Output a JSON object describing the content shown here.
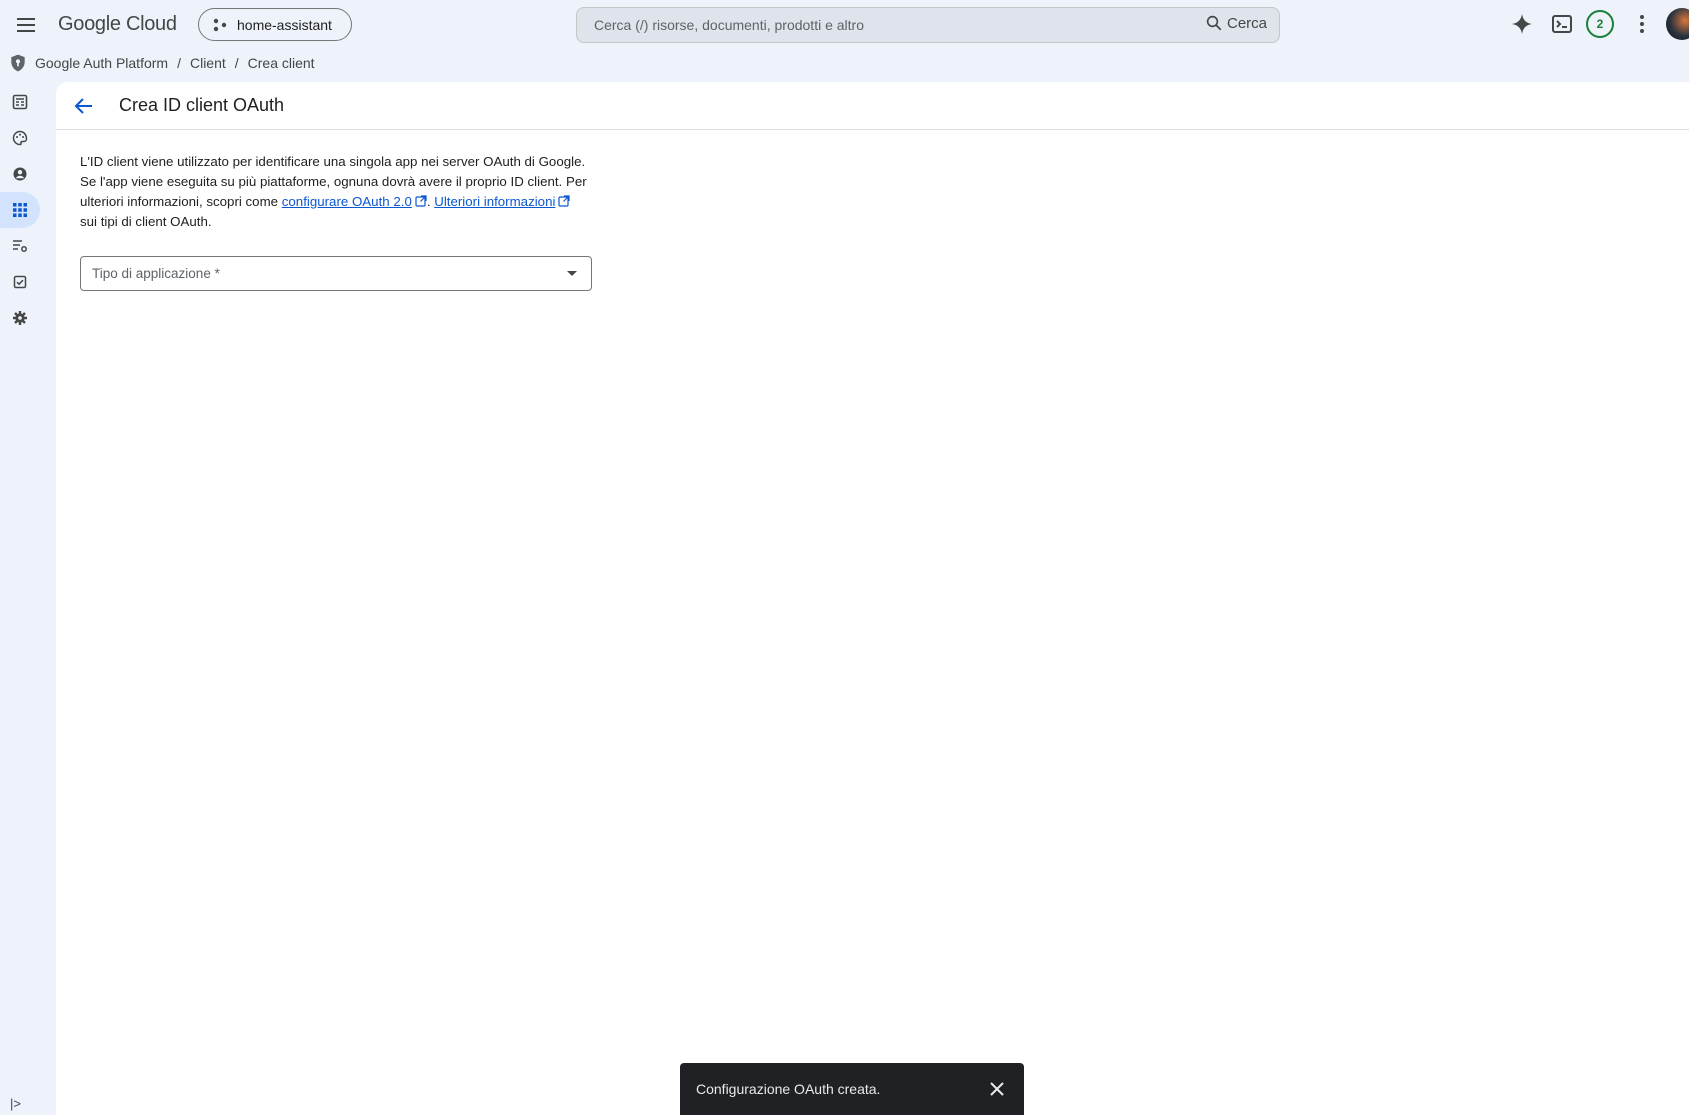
{
  "header": {
    "logo": "Google Cloud",
    "project": "home-assistant",
    "search_placeholder": "Cerca (/) risorse, documenti, prodotti e altro",
    "search_button": "Cerca",
    "notification_count": "2"
  },
  "breadcrumb": {
    "items": [
      "Google Auth Platform",
      "Client",
      "Crea client"
    ],
    "separator": "/"
  },
  "sidebar": {
    "items": [
      {
        "icon": "dashboard-icon"
      },
      {
        "icon": "branding-icon"
      },
      {
        "icon": "audience-icon"
      },
      {
        "icon": "clients-icon",
        "active": true
      },
      {
        "icon": "data-access-icon"
      },
      {
        "icon": "verification-icon"
      },
      {
        "icon": "settings-icon"
      }
    ],
    "expand_label": "|>"
  },
  "page": {
    "title": "Crea ID client OAuth",
    "description": {
      "part1": "L'ID client viene utilizzato per identificare una singola app nei server OAuth di Google. Se l'app viene eseguita su più piattaforme, ognuna dovrà avere il proprio ID client. Per ulteriori informazioni, scopri come ",
      "link1": "configurare OAuth 2.0",
      "part2": ". ",
      "link2": "Ulteriori informazioni",
      "part3": " sui tipi di client OAuth."
    },
    "application_type_placeholder": "Tipo di applicazione *"
  },
  "snackbar": {
    "message": "Configurazione OAuth creata."
  },
  "colors": {
    "accent": "#0b57d0",
    "background": "#eef2fa",
    "badge": "#188038",
    "snackbar": "#202124"
  }
}
